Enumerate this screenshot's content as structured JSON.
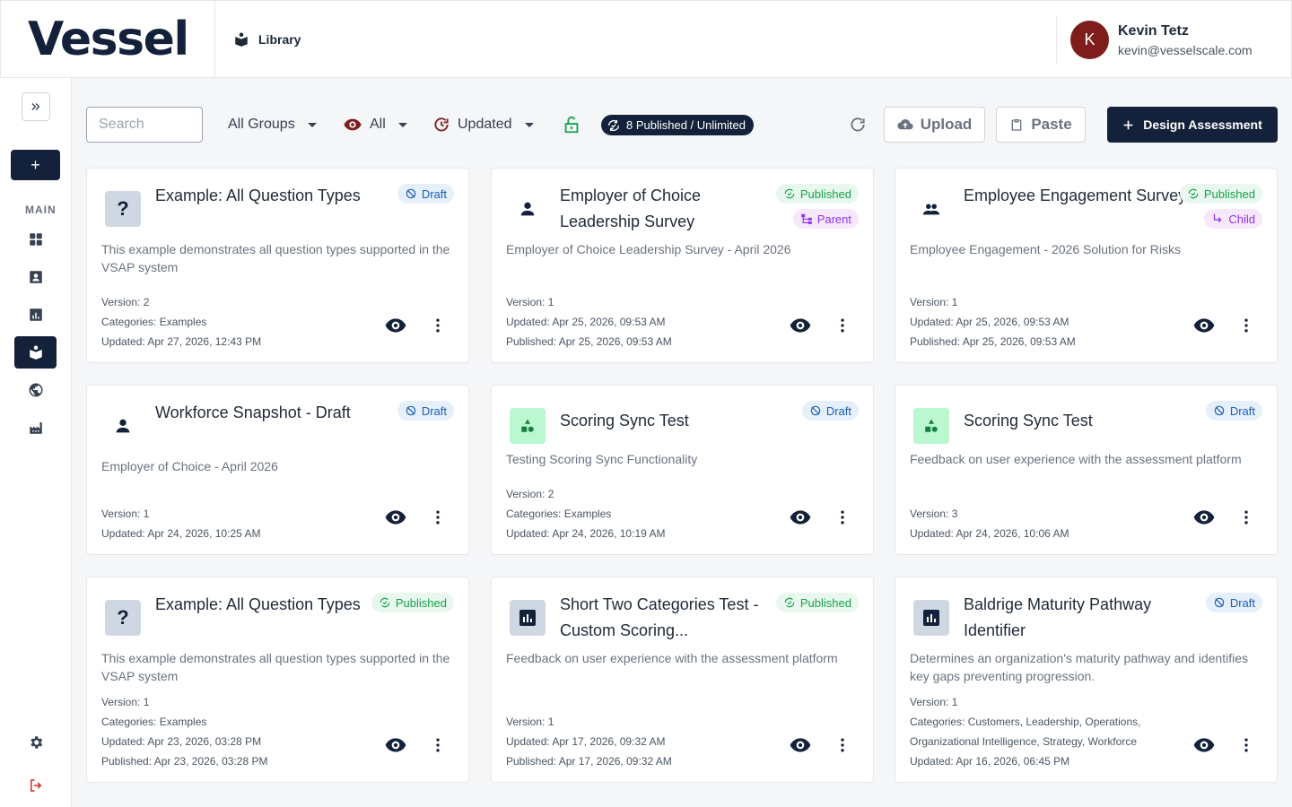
{
  "header": {
    "logo": "Vessel",
    "breadcrumb": "Library",
    "user": {
      "initial": "K",
      "name": "Kevin Tetz",
      "email": "kevin@vesselscale.com"
    }
  },
  "sidebar": {
    "add_label": "+",
    "section_label": "MAIN"
  },
  "toolbar": {
    "search_placeholder": "Search",
    "groups_label": "All Groups",
    "visibility_label": "All",
    "sort_label": "Updated",
    "published_pill": "8 Published / Unlimited",
    "upload_label": "Upload",
    "paste_label": "Paste",
    "design_label": "Design Assessment"
  },
  "colors": {
    "brand": "#13223a",
    "draft": "#1d5fb3",
    "published": "#16a34a",
    "relation": "#9333ea",
    "avatar": "#7f1d1d"
  },
  "cards": [
    {
      "title": "Example: All Question Types",
      "icon": "question-icon",
      "badges": [
        "Draft"
      ],
      "description": "This example demonstrates all question types supported in the VSAP system",
      "meta": [
        "Version: 2",
        "Categories: Examples",
        "Updated: Apr 27, 2026, 12:43 PM"
      ]
    },
    {
      "title": "Employer of Choice Leadership Survey",
      "icon": "person-icon",
      "badges": [
        "Published",
        "Parent"
      ],
      "description": "Employer of Choice Leadership Survey - April 2026",
      "meta": [
        "Version: 1",
        "Updated: Apr 25, 2026, 09:53 AM",
        "Published: Apr 25, 2026, 09:53 AM"
      ]
    },
    {
      "title": "Employee Engagement Survey",
      "icon": "group-icon",
      "badges": [
        "Published",
        "Child"
      ],
      "description": "Employee Engagement - 2026 Solution for Risks",
      "meta": [
        "Version: 1",
        "Updated: Apr 25, 2026, 09:53 AM",
        "Published: Apr 25, 2026, 09:53 AM"
      ]
    },
    {
      "title": "Workforce Snapshot - Draft",
      "icon": "person-icon",
      "badges": [
        "Draft"
      ],
      "description": "Employer of Choice - April 2026",
      "meta": [
        "Version: 1",
        "Updated: Apr 24, 2026, 10:25 AM"
      ]
    },
    {
      "title": "Scoring Sync Test",
      "icon": "shapes-icon",
      "badges": [
        "Draft"
      ],
      "description": "Testing Scoring Sync Functionality",
      "meta": [
        "Version: 2",
        "Categories: Examples",
        "Updated: Apr 24, 2026, 10:19 AM"
      ]
    },
    {
      "title": "Scoring Sync Test",
      "icon": "shapes-icon",
      "badges": [
        "Draft"
      ],
      "description": "Feedback on user experience with the assessment platform",
      "meta": [
        "Version: 3",
        "Updated: Apr 24, 2026, 10:06 AM"
      ]
    },
    {
      "title": "Example: All Question Types",
      "icon": "question-icon",
      "badges": [
        "Published"
      ],
      "description": "This example demonstrates all question types supported in the VSAP system",
      "meta": [
        "Version: 1",
        "Categories: Examples",
        "Updated: Apr 23, 2026, 03:28 PM",
        "Published: Apr 23, 2026, 03:28 PM"
      ]
    },
    {
      "title": "Short Two Categories Test - Custom Scoring...",
      "icon": "chart-icon",
      "badges": [
        "Published"
      ],
      "description": "Feedback on user experience with the assessment platform",
      "meta": [
        "Version: 1",
        "Updated: Apr 17, 2026, 09:32 AM",
        "Published: Apr 17, 2026, 09:32 AM"
      ]
    },
    {
      "title": "Baldrige Maturity Pathway Identifier",
      "icon": "chart-icon",
      "badges": [
        "Draft"
      ],
      "description": "Determines an organization's maturity pathway and identifies key gaps preventing progression.",
      "meta": [
        "Version: 1",
        "Categories: Customers, Leadership, Operations, Organizational Intelligence, Strategy, Workforce",
        "Updated: Apr 16, 2026, 06:45 PM"
      ]
    }
  ]
}
